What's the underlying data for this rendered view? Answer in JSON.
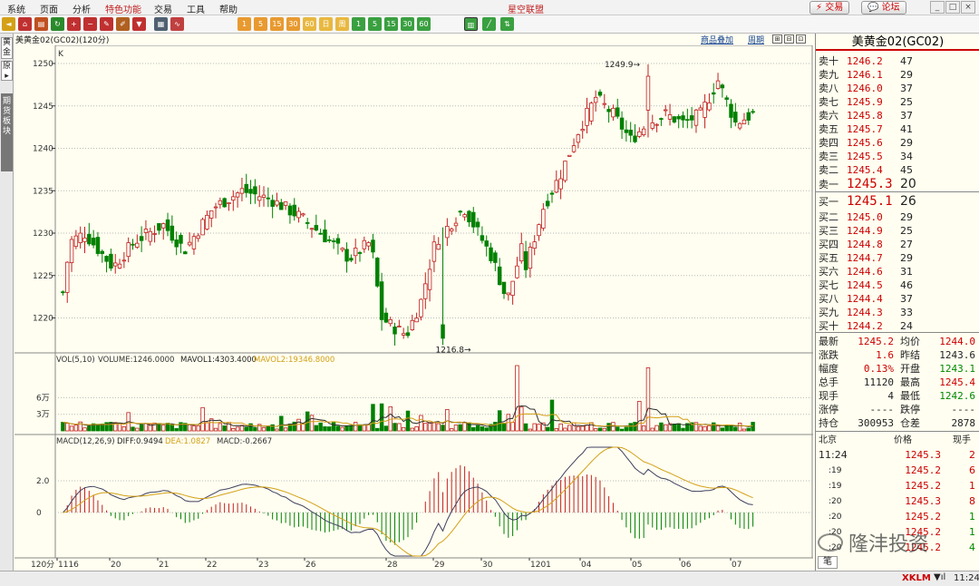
{
  "menu": {
    "items": [
      "系统",
      "页面",
      "分析",
      "特色功能",
      "交易",
      "工具",
      "帮助"
    ],
    "app_title": "星空联盟",
    "trade_button": "交易",
    "forum_button": "论坛"
  },
  "toolbar": {
    "period_buttons": [
      "1",
      "5",
      "15",
      "30",
      "60",
      "日",
      "周",
      "月"
    ]
  },
  "side_tabs": [
    "黄金",
    "原",
    "期货板块"
  ],
  "chart_header": {
    "instrument": "美黄金02(GC02)(120分)",
    "overlay_link": "商品叠加",
    "period_link": "周期",
    "k_label": "K"
  },
  "price_axis": [
    "1250",
    "1245",
    "1240",
    "1235",
    "1230",
    "1225",
    "1220"
  ],
  "price_annotations": {
    "high": "1249.9",
    "low": "1216.8"
  },
  "volume_panel": {
    "legend_prefix": "VOL(5,10)",
    "volume": "VOLUME:1246.0000",
    "mavol1": "MAVOL1:4303.4000",
    "mavol2": "MAVOL2:19346.8000",
    "axis": [
      "6万",
      "3万"
    ]
  },
  "macd_panel": {
    "legend_prefix": "MACD(12,26,9)",
    "diff": "DIFF:0.9494",
    "dea": "DEA:1.0827",
    "macd": "MACD:-0.2667",
    "axis": [
      "2.0",
      "0"
    ]
  },
  "x_axis": {
    "period_label": "120分",
    "labels": [
      "1116",
      "20",
      "21",
      "22",
      "23",
      "26",
      "28",
      "29",
      "30",
      "1201",
      "04",
      "05",
      "06",
      "07"
    ]
  },
  "right_panel": {
    "title": "美黄金02(GC02)",
    "asks": [
      {
        "label": "卖十",
        "price": "1246.2",
        "vol": "47"
      },
      {
        "label": "卖九",
        "price": "1246.1",
        "vol": "29"
      },
      {
        "label": "卖八",
        "price": "1246.0",
        "vol": "37"
      },
      {
        "label": "卖七",
        "price": "1245.9",
        "vol": "25"
      },
      {
        "label": "卖六",
        "price": "1245.8",
        "vol": "37"
      },
      {
        "label": "卖五",
        "price": "1245.7",
        "vol": "41"
      },
      {
        "label": "卖四",
        "price": "1245.6",
        "vol": "29"
      },
      {
        "label": "卖三",
        "price": "1245.5",
        "vol": "34"
      },
      {
        "label": "卖二",
        "price": "1245.4",
        "vol": "45"
      },
      {
        "label": "卖一",
        "price": "1245.3",
        "vol": "20"
      }
    ],
    "bids": [
      {
        "label": "买一",
        "price": "1245.1",
        "vol": "26"
      },
      {
        "label": "买二",
        "price": "1245.0",
        "vol": "29"
      },
      {
        "label": "买三",
        "price": "1244.9",
        "vol": "25"
      },
      {
        "label": "买四",
        "price": "1244.8",
        "vol": "27"
      },
      {
        "label": "买五",
        "price": "1244.7",
        "vol": "29"
      },
      {
        "label": "买六",
        "price": "1244.6",
        "vol": "31"
      },
      {
        "label": "买七",
        "price": "1244.5",
        "vol": "46"
      },
      {
        "label": "买八",
        "price": "1244.4",
        "vol": "37"
      },
      {
        "label": "买九",
        "price": "1244.3",
        "vol": "33"
      },
      {
        "label": "买十",
        "price": "1244.2",
        "vol": "24"
      }
    ],
    "stats": [
      {
        "l1": "最新",
        "v1": "1245.2",
        "c1": "#c00",
        "l2": "均价",
        "v2": "1244.0",
        "c2": "#c00"
      },
      {
        "l1": "涨跌",
        "v1": "1.6",
        "c1": "#c00",
        "l2": "昨结",
        "v2": "1243.6",
        "c2": "#222"
      },
      {
        "l1": "幅度",
        "v1": "0.13%",
        "c1": "#c00",
        "l2": "开盘",
        "v2": "1243.1",
        "c2": "#080"
      },
      {
        "l1": "总手",
        "v1": "11120",
        "c1": "#222",
        "l2": "最高",
        "v2": "1245.4",
        "c2": "#c00"
      },
      {
        "l1": "现手",
        "v1": "4",
        "c1": "#222",
        "l2": "最低",
        "v2": "1242.6",
        "c2": "#080"
      },
      {
        "l1": "涨停",
        "v1": "----",
        "c1": "#222",
        "l2": "跌停",
        "v2": "----",
        "c2": "#222"
      },
      {
        "l1": "持仓",
        "v1": "300953",
        "c1": "#222",
        "l2": "仓差",
        "v2": "2878",
        "c2": "#222"
      }
    ],
    "ticks_header": {
      "location": "北京",
      "price": "价格",
      "qty": "现手"
    },
    "ticks": [
      {
        "time": "11:24",
        "price": "1245.3",
        "qty": "2",
        "pc": "#c00",
        "qc": "#c00"
      },
      {
        "time": ":19",
        "price": "1245.2",
        "qty": "6",
        "pc": "#c00",
        "qc": "#c00"
      },
      {
        "time": ":19",
        "price": "1245.2",
        "qty": "1",
        "pc": "#c00",
        "qc": "#c00"
      },
      {
        "time": ":20",
        "price": "1245.3",
        "qty": "8",
        "pc": "#c00",
        "qc": "#c00"
      },
      {
        "time": ":20",
        "price": "1245.2",
        "qty": "1",
        "pc": "#c00",
        "qc": "#080"
      },
      {
        "time": ":20",
        "price": "1245.2",
        "qty": "1",
        "pc": "#c00",
        "qc": "#080"
      },
      {
        "time": ":20",
        "price": "1245.2",
        "qty": "4",
        "pc": "#c00",
        "qc": "#080"
      }
    ],
    "bottom_tab": "笔"
  },
  "status": {
    "brand": "XKLM",
    "time": "11:24"
  },
  "watermark": "隆沣投资",
  "colors": {
    "up": "#c02020",
    "down": "#008000",
    "ma1": "#303030",
    "ma2": "#d4a017"
  }
}
